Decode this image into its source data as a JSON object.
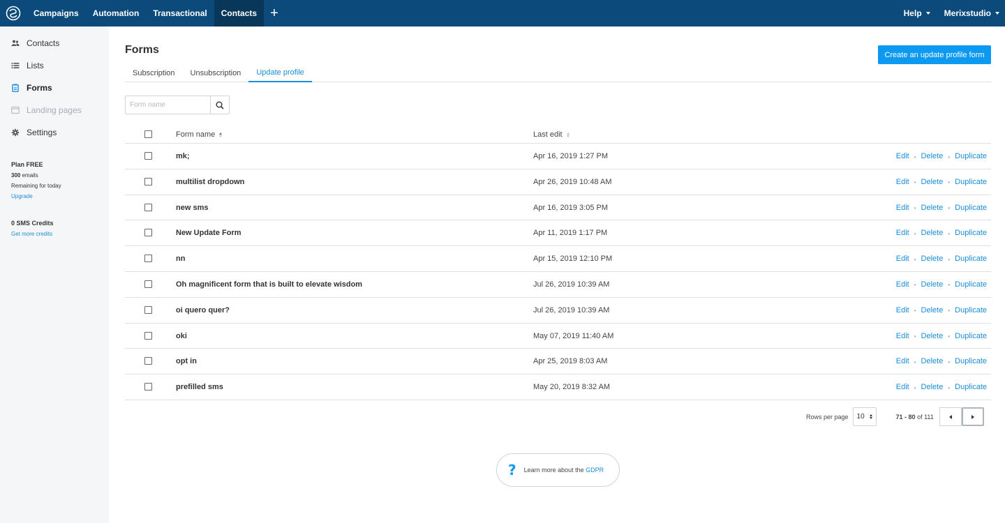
{
  "nav": {
    "items": [
      {
        "label": "Campaigns",
        "active": false
      },
      {
        "label": "Automation",
        "active": false
      },
      {
        "label": "Transactional",
        "active": false
      },
      {
        "label": "Contacts",
        "active": true
      }
    ],
    "plus": "+",
    "help": "Help",
    "account": "Merixstudio"
  },
  "sidebar": {
    "items": [
      {
        "label": "Contacts",
        "icon": "users-icon",
        "state": "normal"
      },
      {
        "label": "Lists",
        "icon": "list-icon",
        "state": "normal"
      },
      {
        "label": "Forms",
        "icon": "clipboard-icon",
        "state": "active"
      },
      {
        "label": "Landing pages",
        "icon": "browser-icon",
        "state": "disabled"
      },
      {
        "label": "Settings",
        "icon": "gear-icon",
        "state": "normal"
      }
    ],
    "plan": {
      "title": "Plan FREE",
      "emails_count": "300",
      "emails_label": " emails",
      "remaining": "Remaining for today",
      "upgrade": "Upgrade"
    },
    "sms": {
      "title": "0 SMS Credits",
      "link": "Get more credits"
    }
  },
  "main": {
    "title": "Forms",
    "create_button": "Create an update profile form",
    "tabs": [
      {
        "label": "Subscription",
        "active": false
      },
      {
        "label": "Unsubscription",
        "active": false
      },
      {
        "label": "Update profile",
        "active": true
      }
    ],
    "search": {
      "placeholder": "Form name"
    },
    "columns": {
      "name": "Form name",
      "last_edit": "Last edit"
    },
    "rows": [
      {
        "name": "mk;",
        "date": "Apr 16, 2019 1:27 PM"
      },
      {
        "name": "multilist dropdown",
        "date": "Apr 26, 2019 10:48 AM"
      },
      {
        "name": "new sms",
        "date": "Apr 16, 2019 3:05 PM"
      },
      {
        "name": "New Update Form",
        "date": "Apr 11, 2019 1:17 PM"
      },
      {
        "name": "nn",
        "date": "Apr 15, 2019 12:10 PM"
      },
      {
        "name": "Oh magnificent form that is built to elevate wisdom",
        "date": "Jul 26, 2019 10:39 AM"
      },
      {
        "name": "oi quero quer?",
        "date": "Jul 26, 2019 10:39 AM"
      },
      {
        "name": "oki",
        "date": "May 07, 2019 11:40 AM"
      },
      {
        "name": "opt in",
        "date": "Apr 25, 2019 8:03 AM"
      },
      {
        "name": "prefilled sms",
        "date": "May 20, 2019 8:32 AM"
      }
    ],
    "row_actions": {
      "edit": "Edit",
      "delete": "Delete",
      "duplicate": "Duplicate",
      "separator": "•"
    },
    "pagination": {
      "rows_per_page_label": "Rows per page",
      "rows_per_page": "10",
      "range": "71 - 80",
      "of_label": " of ",
      "total": "111"
    },
    "gdpr": {
      "text": "Learn more about the ",
      "link": "GDPR",
      "icon": "?"
    }
  },
  "colors": {
    "nav_bg": "#0b4a7a",
    "nav_active": "#083759",
    "accent": "#0b99f2",
    "link": "#1a8cd8"
  }
}
